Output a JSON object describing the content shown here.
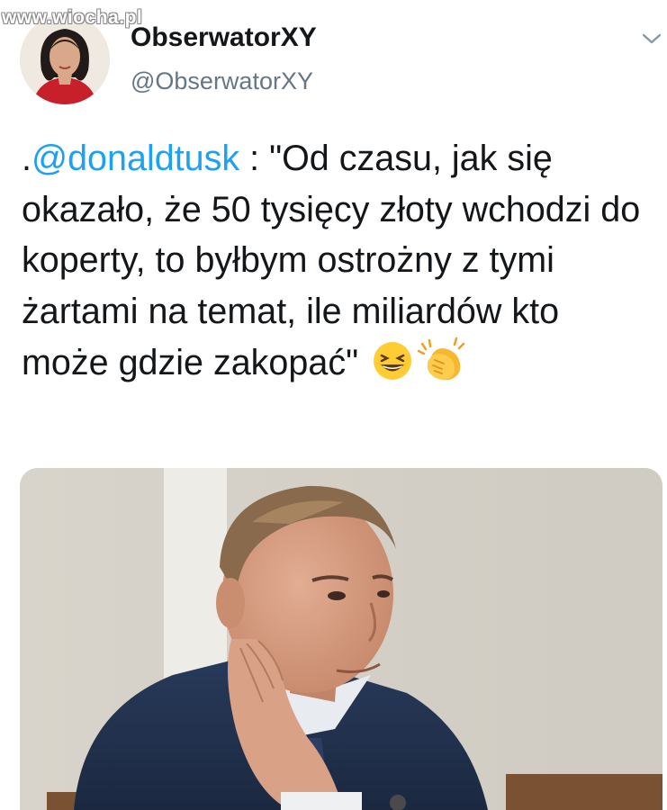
{
  "watermark": "www.wiocha.pl",
  "author": {
    "display_name": "ObserwatorXY",
    "handle": "@ObserwatorXY"
  },
  "tweet": {
    "prefix": ".",
    "mention": "@donaldtusk",
    "text": " : \"Od czasu, jak się okazało, że 50 tysięcy złoty wchodzi do koperty, to byłbym ostrożny z tymi żartami na temat, ile miliardów kto może gdzie zakopać\"",
    "emojis": [
      "grinning-squinting-face-icon",
      "clapping-hands-icon"
    ]
  },
  "colors": {
    "mention": "#1da1f2",
    "handle": "#657786",
    "text": "#14171a"
  }
}
